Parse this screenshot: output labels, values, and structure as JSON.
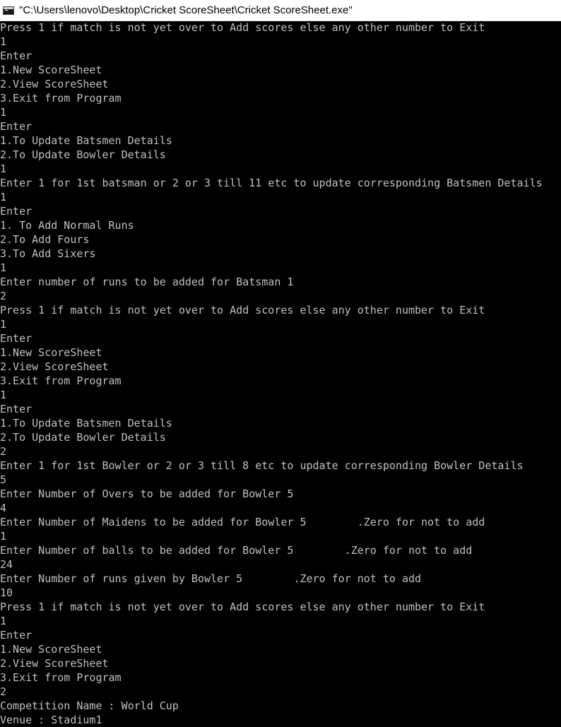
{
  "window": {
    "title": "\"C:\\Users\\lenovo\\Desktop\\Cricket ScoreSheet\\Cricket ScoreSheet.exe\"",
    "icon": "console-app-icon"
  },
  "colors": {
    "background": "#000000",
    "text": "#c0c0c0"
  },
  "console": {
    "lines": [
      "Press 1 if match is not yet over to Add scores else any other number to Exit",
      "1",
      "Enter",
      "1.New ScoreSheet",
      "2.View ScoreSheet",
      "3.Exit from Program",
      "1",
      "Enter",
      "1.To Update Batsmen Details",
      "2.To Update Bowler Details",
      "1",
      "Enter 1 for 1st batsman or 2 or 3 till 11 etc to update corresponding Batsmen Details",
      "1",
      "Enter",
      "1. To Add Normal Runs",
      "2.To Add Fours",
      "3.To Add Sixers",
      "1",
      "Enter number of runs to be added for Batsman 1",
      "2",
      "Press 1 if match is not yet over to Add scores else any other number to Exit",
      "1",
      "Enter",
      "1.New ScoreSheet",
      "2.View ScoreSheet",
      "3.Exit from Program",
      "1",
      "Enter",
      "1.To Update Batsmen Details",
      "2.To Update Bowler Details",
      "2",
      "Enter 1 for 1st Bowler or 2 or 3 till 8 etc to update corresponding Bowler Details",
      "5",
      "Enter Number of Overs to be added for Bowler 5",
      "4",
      "Enter Number of Maidens to be added for Bowler 5        .Zero for not to add",
      "1",
      "Enter Number of balls to be added for Bowler 5        .Zero for not to add",
      "24",
      "Enter Number of runs given by Bowler 5        .Zero for not to add",
      "10",
      "Press 1 if match is not yet over to Add scores else any other number to Exit",
      "1",
      "Enter",
      "1.New ScoreSheet",
      "2.View ScoreSheet",
      "3.Exit from Program",
      "2",
      "Competition Name : World Cup",
      "Venue : Stadium1"
    ]
  }
}
